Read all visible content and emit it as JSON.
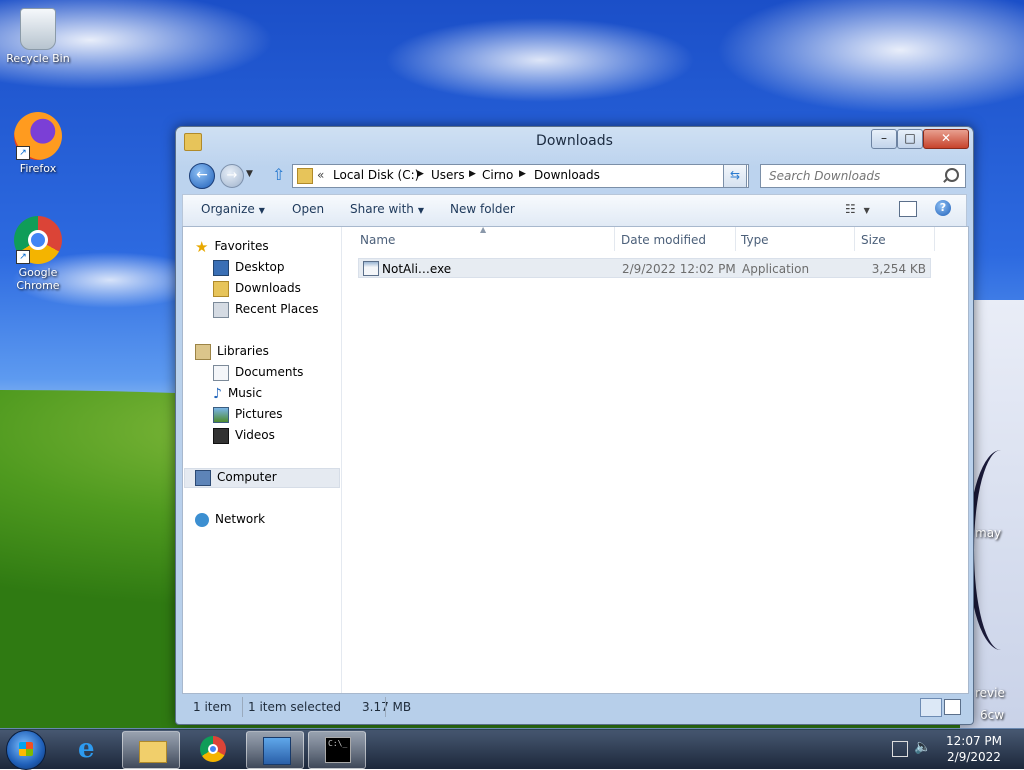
{
  "desktop": {
    "icons": [
      {
        "label": "Recycle Bin",
        "icon": "recycle-bin-icon"
      },
      {
        "label": "Firefox",
        "icon": "firefox-icon"
      },
      {
        "label": "Google Chrome",
        "icon": "chrome-icon"
      }
    ],
    "background_text": {
      "line1": "may",
      "line2": "revie",
      "line3": "6cw"
    }
  },
  "window": {
    "title": "Downloads",
    "address": {
      "chevrons": "«",
      "crumbs": [
        "Local Disk (C:)",
        "Users",
        "Cirno",
        "Downloads"
      ]
    },
    "search": {
      "placeholder": "Search Downloads"
    },
    "toolbar": {
      "organize": "Organize",
      "open": "Open",
      "share_with": "Share with",
      "new_folder": "New folder"
    },
    "nav_pane": {
      "favorites": {
        "label": "Favorites",
        "items": [
          "Desktop",
          "Downloads",
          "Recent Places"
        ]
      },
      "libraries": {
        "label": "Libraries",
        "items": [
          "Documents",
          "Music",
          "Pictures",
          "Videos"
        ]
      },
      "computer": "Computer",
      "network": "Network"
    },
    "columns": [
      "Name",
      "Date modified",
      "Type",
      "Size"
    ],
    "files": [
      {
        "name": "NotAli…exe",
        "date_modified": "2/9/2022 12:02 PM",
        "type": "Application",
        "size": "3,254 KB"
      }
    ],
    "status": {
      "count": "1 item",
      "selection": "1 item selected",
      "size": "3.17 MB"
    }
  },
  "taskbar": {
    "apps": [
      "internet-explorer-icon",
      "windows-explorer-icon",
      "chrome-icon",
      "remote-desktop-icon",
      "command-prompt-icon"
    ],
    "clock": {
      "time": "12:07 PM",
      "date": "2/9/2022"
    }
  }
}
